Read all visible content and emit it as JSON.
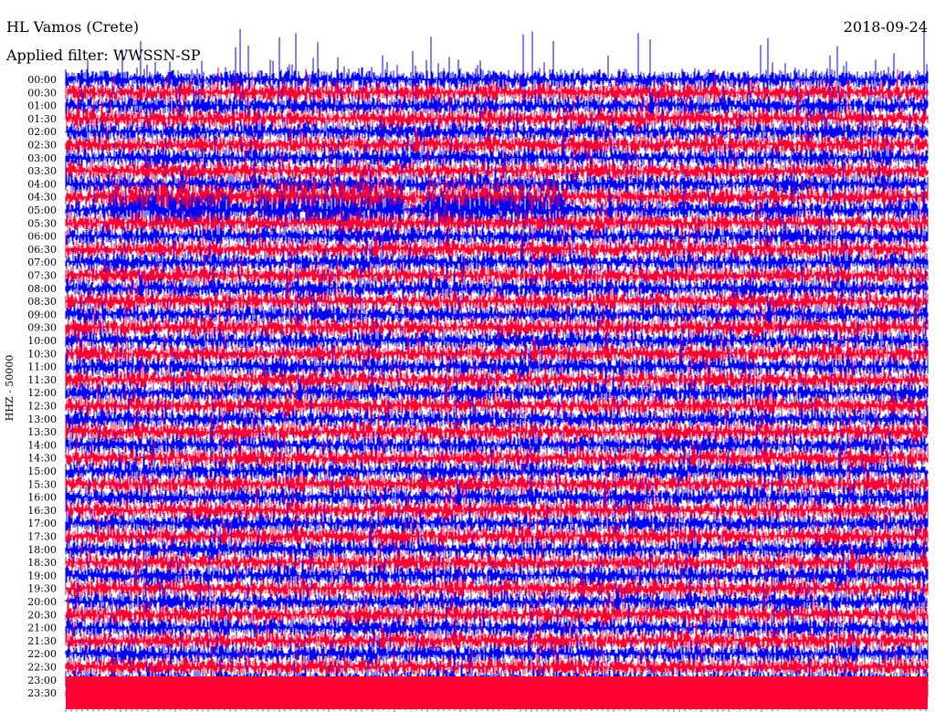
{
  "header": {
    "station": "HL Vamos (Crete)",
    "date": "2018-09-24",
    "filter": "Applied filter: WWSSN-SP"
  },
  "chart_data": {
    "type": "line",
    "title": "HL Vamos (Crete)",
    "subtitle": "Applied filter: WWSSN-SP",
    "ylabel": "HHZ - 50000",
    "xlabel": "",
    "row_labels": [
      "00:00",
      "00:30",
      "01:00",
      "01:30",
      "02:00",
      "02:30",
      "03:00",
      "03:30",
      "04:00",
      "04:30",
      "05:00",
      "05:30",
      "06:00",
      "06:30",
      "07:00",
      "07:30",
      "08:00",
      "08:30",
      "09:00",
      "09:30",
      "10:00",
      "10:30",
      "11:00",
      "11:30",
      "12:00",
      "12:30",
      "13:00",
      "13:30",
      "14:00",
      "14:30",
      "15:00",
      "15:30",
      "16:00",
      "16:30",
      "17:00",
      "17:30",
      "18:00",
      "18:30",
      "19:00",
      "19:30",
      "20:00",
      "20:30",
      "21:00",
      "21:30",
      "22:00",
      "22:30",
      "23:00",
      "23:30"
    ],
    "trace_colors": [
      "#0000ff",
      "#ff0033"
    ],
    "grid": false
  }
}
